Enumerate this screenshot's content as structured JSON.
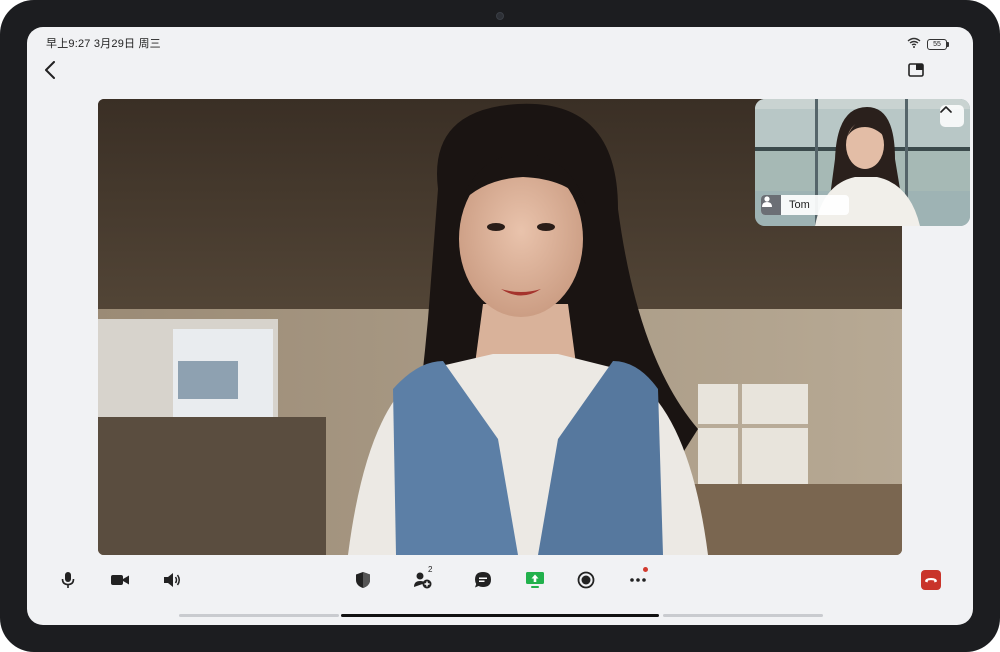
{
  "status_bar": {
    "time_text": "早上9:27 3月29日 周三",
    "battery_level": "55"
  },
  "remote_participant": {
    "name": "Tom"
  },
  "toolbar": {
    "participants_count": "2",
    "more_has_notification": true
  },
  "colors": {
    "share_screen_green": "#22b14c",
    "end_call_red": "#c9342a",
    "notification_dot": "#d23b2f"
  },
  "icons": [
    "back-arrow-icon",
    "pip-layout-icon",
    "microphone-icon",
    "camera-icon",
    "speaker-icon",
    "security-shield-icon",
    "add-participant-icon",
    "chat-icon",
    "share-screen-icon",
    "record-icon",
    "more-icon",
    "end-call-icon",
    "chevron-up-icon",
    "user-icon",
    "wifi-icon",
    "battery-icon"
  ]
}
